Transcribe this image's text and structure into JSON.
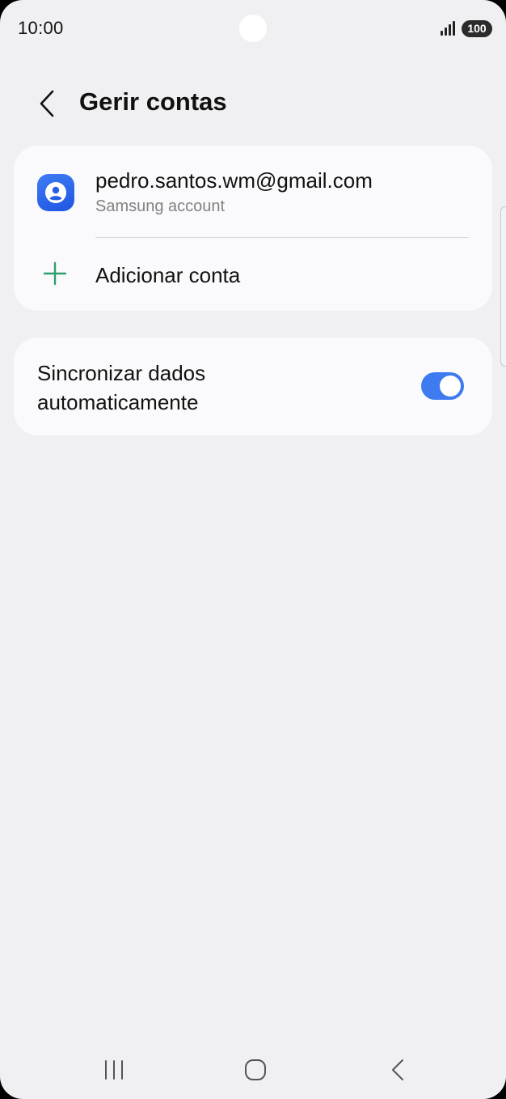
{
  "status_bar": {
    "time": "10:00",
    "battery": "100",
    "icons": [
      "signal-icon",
      "battery-icon"
    ]
  },
  "header": {
    "title": "Gerir contas",
    "back_icon": "chevron-left-icon"
  },
  "accounts": [
    {
      "email": "pedro.santos.wm@gmail.com",
      "type": "Samsung account",
      "icon": "samsung-account-icon"
    }
  ],
  "add_account": {
    "label": "Adicionar conta",
    "icon": "plus-icon"
  },
  "sync": {
    "label": "Sincronizar dados automaticamente",
    "enabled": true
  },
  "navigation_bar": {
    "icons": [
      "recents-icon",
      "home-icon",
      "back-icon"
    ]
  },
  "colors": {
    "background": "#f0f0f2",
    "card": "#fafafc",
    "accent": "#3e7bf0",
    "plus_green": "#2f9e6e",
    "secondary_text": "#818181"
  }
}
